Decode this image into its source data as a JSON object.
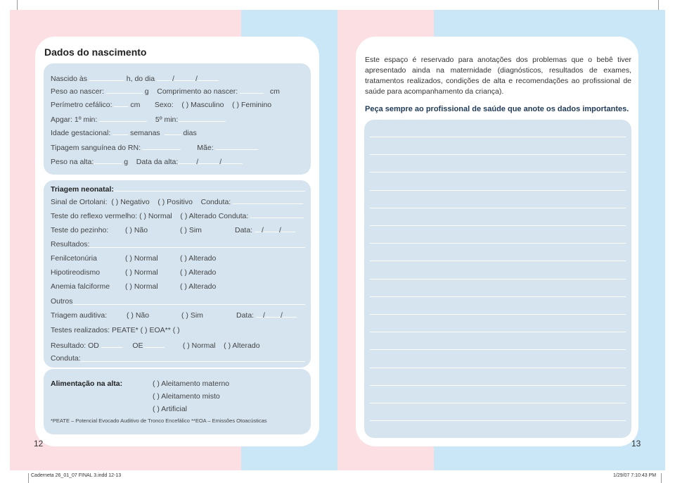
{
  "colors": {
    "pink": "#fbdfe3",
    "blue": "#c9e7f6",
    "box": "#d5e4ef"
  },
  "left": {
    "title": "Dados do nascimento",
    "birth": [
      [
        "Nascido às",
        "h, do dia",
        "/",
        "/"
      ],
      [
        "Peso ao nascer:",
        "g",
        "Comprimento ao nascer:",
        "cm"
      ],
      [
        "Perímetro cefálico:",
        "cm",
        "Sexo:",
        "(  ) Masculino",
        "(  ) Feminino"
      ],
      [
        "Apgar:  1º min:",
        "5º min:"
      ],
      [
        "Idade gestacional:",
        "semanas",
        "dias"
      ],
      [
        "Tipagem sanguínea do RN:",
        "Mãe:"
      ],
      [
        "Peso na alta:",
        "g",
        "Data da alta:",
        "/",
        "/"
      ]
    ],
    "triage": {
      "title": "Triagem neonatal:",
      "ortolani": [
        "Sinal de Ortolani:",
        "(  ) Negativo",
        "(  ) Positivo",
        "Conduta:"
      ],
      "reflexo": [
        "Teste do reflexo vermelho:",
        "(  ) Normal",
        "(  ) Alterado",
        "Conduta:"
      ],
      "pezinho": [
        "Teste do pezinho:",
        "(  ) Não",
        "(  ) Sim",
        "Data:",
        "/",
        "/"
      ],
      "resultados": "Resultados:",
      "tests": [
        [
          "Fenilcetonúria",
          "(  ) Normal",
          "(  ) Alterado"
        ],
        [
          "Hipotireodismo",
          "(  ) Normal",
          "(  ) Alterado"
        ],
        [
          "Anemia falciforme",
          "(  ) Normal",
          "(  ) Alterado"
        ]
      ],
      "outros": "Outros",
      "auditiva": [
        "Triagem auditiva:",
        "(  ) Não",
        "(  ) Sim",
        "Data:",
        "/",
        "/"
      ],
      "realizados": "Testes realizados: PEATE* (   )  EOA** (   )",
      "resultado": [
        "Resultado: OD",
        "OE",
        "(  ) Normal",
        "(  ) Alterado"
      ],
      "conduta": "Conduta:"
    },
    "feeding": {
      "title": "Alimentação na alta:",
      "options": [
        "(  ) Aleitamento materno",
        "(  ) Aleitamento misto",
        "(  ) Artificial"
      ],
      "footnote": "*PEATE – Potencial Evocado Auditivo de Tronco Encefálico   **EOA – Emissões Otoacústicas"
    },
    "page": "12"
  },
  "right": {
    "intro": "Este espaço é reservado para anotações dos problemas que o bebê tiver apresentado ainda na maternidade (diagnósticos, resultados de exames, tratamentos realizados, condições de alta e recomendações ao profissional de saúde para acompanhamento da criança).",
    "emphasis": "Peça sempre ao profissional de saúde que anote os dados importantes.",
    "page": "13"
  },
  "slug": {
    "file": "Caderneta 26_01_07 FINAL 3.indd   12-13",
    "date": "1/29/07   7:10:43 PM"
  }
}
